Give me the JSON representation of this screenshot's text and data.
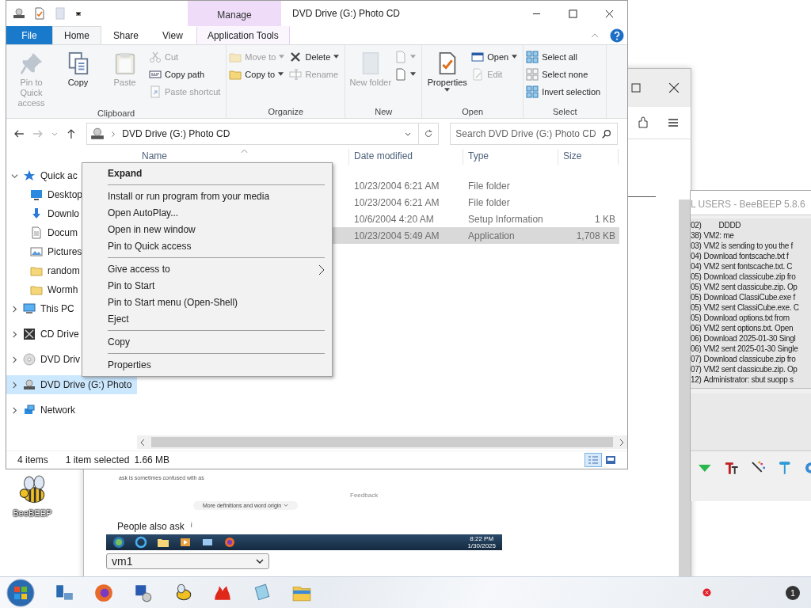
{
  "browser": {
    "snippet": "ask is sometimes confused with as",
    "feedback": "Feedback",
    "more_button": "More definitions and word origin",
    "people_also_ask": "People also ask",
    "info_mark": "i",
    "vm_taskbar": {
      "time": "8:22 PM",
      "date": "1/30/2025"
    },
    "vm_select": "vm1"
  },
  "beebeep": {
    "title": "L USERS - BeeBEEP 5.8.6",
    "messages": [
      {
        "time": "02)",
        "text": "DDDD",
        "kind": "indented"
      },
      {
        "time": "38)",
        "text": "VM2: me",
        "kind": "plain"
      },
      {
        "time": "03)",
        "text": "VM2 is sending to you the f",
        "kind": "plain"
      },
      {
        "time": "04)",
        "text": "Download fontscache.txt f",
        "kind": "plain"
      },
      {
        "time": "04)",
        "text": "VM2 sent fontscache.txt. C",
        "kind": "plain"
      },
      {
        "time": "05)",
        "text": "Download classicube.zip fro",
        "kind": "plain"
      },
      {
        "time": "05)",
        "text": "VM2 sent classicube.zip. Op",
        "kind": "plain"
      },
      {
        "time": "05)",
        "text": "Download ClassiCube.exe f",
        "kind": "plain"
      },
      {
        "time": "05)",
        "text": "VM2 sent ClassiCube.exe. C",
        "kind": "plain"
      },
      {
        "time": "05)",
        "text": "Download options.txt from",
        "kind": "plain"
      },
      {
        "time": "06)",
        "text": "VM2 sent options.txt. Open",
        "kind": "plain"
      },
      {
        "time": "06)",
        "text": "Download 2025-01-30 Singl",
        "kind": "plain"
      },
      {
        "time": "06)",
        "text": "VM2 sent 2025-01-30 Single",
        "kind": "plain"
      },
      {
        "time": "07)",
        "text": "Download classicube.zip fro",
        "kind": "plain"
      },
      {
        "time": "07)",
        "text": "VM2 sent classicube.zip. Op",
        "kind": "plain"
      },
      {
        "time": "12)",
        "text": "Administrator: sbut suopp s",
        "kind": "plain"
      }
    ]
  },
  "desktop_icons": [
    {
      "label": "BeeBEEP"
    }
  ],
  "taskbar": {
    "notification_count": "1"
  },
  "explorer": {
    "title": "DVD Drive (G:) Photo CD",
    "contextual_group": "Manage",
    "tabs": [
      {
        "label": "File",
        "kind": "file",
        "selected": false
      },
      {
        "label": "Home",
        "kind": "normal",
        "selected": true
      },
      {
        "label": "Share",
        "kind": "normal",
        "selected": false
      },
      {
        "label": "View",
        "kind": "normal",
        "selected": false
      },
      {
        "label": "Application Tools",
        "kind": "contextual",
        "selected": false
      }
    ],
    "ribbon_groups": [
      {
        "label": "Clipboard",
        "items": [
          {
            "kind": "large",
            "label": "Pin to Quick access",
            "disabled": true,
            "dropdown": false
          },
          {
            "kind": "large",
            "label": "Copy",
            "disabled": false,
            "dropdown": false
          },
          {
            "kind": "large",
            "label": "Paste",
            "disabled": true,
            "dropdown": false
          },
          {
            "kind": "stack",
            "commands": [
              {
                "label": "Cut",
                "disabled": true,
                "dropdown": false
              },
              {
                "label": "Copy path",
                "disabled": false,
                "dropdown": false
              },
              {
                "label": "Paste shortcut",
                "disabled": true,
                "dropdown": false
              }
            ]
          }
        ]
      },
      {
        "label": "Organize",
        "items": [
          {
            "kind": "stack",
            "commands": [
              {
                "label": "Move to",
                "disabled": true,
                "dropdown": true
              },
              {
                "label": "Copy to",
                "disabled": false,
                "dropdown": true
              }
            ]
          },
          {
            "kind": "stack",
            "commands": [
              {
                "label": "Delete",
                "disabled": false,
                "dropdown": true
              },
              {
                "label": "Rename",
                "disabled": true,
                "dropdown": false
              }
            ]
          }
        ]
      },
      {
        "label": "New",
        "items": [
          {
            "kind": "large",
            "label": "New folder",
            "disabled": true,
            "dropdown": false
          },
          {
            "kind": "stack",
            "commands": [
              {
                "disabled": true,
                "dropdown": true
              },
              {
                "disabled": false,
                "dropdown": true
              }
            ]
          }
        ]
      },
      {
        "label": "Open",
        "items": [
          {
            "kind": "large",
            "label": "Properties",
            "disabled": false,
            "dropdown": true
          },
          {
            "kind": "stack",
            "commands": [
              {
                "label": "Open",
                "disabled": false,
                "dropdown": true
              },
              {
                "label": "Edit",
                "disabled": true,
                "dropdown": false
              }
            ]
          }
        ]
      },
      {
        "label": "Select",
        "items": [
          {
            "kind": "stack",
            "commands": [
              {
                "label": "Select all",
                "disabled": false,
                "dropdown": false
              },
              {
                "label": "Select none",
                "disabled": false,
                "dropdown": false
              },
              {
                "label": "Invert selection",
                "disabled": false,
                "dropdown": false
              }
            ]
          }
        ]
      }
    ],
    "address": "DVD Drive (G:) Photo CD",
    "search": {
      "placeholder": "Search DVD Drive (G:) Photo CD"
    },
    "nav": [
      {
        "label": "Quick ac",
        "expanded": true,
        "selected": false,
        "children": [
          {
            "label": "Desktop",
            "selected": false
          },
          {
            "label": "Downlo",
            "selected": false
          },
          {
            "label": "Docum",
            "selected": false
          },
          {
            "label": "Pictures",
            "selected": false
          },
          {
            "label": "random",
            "selected": false
          },
          {
            "label": "Wormh",
            "selected": false
          }
        ]
      },
      {
        "label": "This PC",
        "expanded": false,
        "selected": false
      },
      {
        "label": "CD Drive",
        "expanded": false,
        "selected": false
      },
      {
        "label": "DVD Driv",
        "expanded": false,
        "selected": false
      },
      {
        "label": "DVD Drive (G:) Photo",
        "expanded": false,
        "selected": true
      },
      {
        "label": "Network",
        "expanded": false,
        "selected": false
      }
    ],
    "columns": [
      "Name",
      "Date modified",
      "Type",
      "Size"
    ],
    "rows": [
      {
        "date": "10/23/2004 6:21 AM",
        "type": "File folder",
        "selected": false
      },
      {
        "date": "10/23/2004 6:21 AM",
        "type": "File folder",
        "selected": false
      },
      {
        "date": "10/6/2004 4:20 AM",
        "type": "Setup Information",
        "size": "1 KB",
        "selected": false
      },
      {
        "date": "10/23/2004 5:49 AM",
        "type": "Application",
        "size": "1,708 KB",
        "selected": true
      }
    ],
    "status": {
      "count": "4 items",
      "selection": "1 item selected",
      "size": "1.66 MB"
    },
    "view_buttons": [
      {
        "selected": true
      },
      {
        "selected": false
      }
    ]
  },
  "context_menu": [
    {
      "kind": "default",
      "label": "Expand"
    },
    {
      "kind": "separator"
    },
    {
      "kind": "item",
      "label": "Install or run program from your media"
    },
    {
      "kind": "item",
      "label": "Open AutoPlay..."
    },
    {
      "kind": "item",
      "label": "Open in new window"
    },
    {
      "kind": "item",
      "label": "Pin to Quick access"
    },
    {
      "kind": "separator"
    },
    {
      "kind": "submenu",
      "label": "Give access to"
    },
    {
      "kind": "item",
      "label": "Pin to Start"
    },
    {
      "kind": "item",
      "label": "Pin to Start menu (Open-Shell)"
    },
    {
      "kind": "item",
      "label": "Eject"
    },
    {
      "kind": "separator"
    },
    {
      "kind": "item",
      "label": "Copy"
    },
    {
      "kind": "separator"
    },
    {
      "kind": "item",
      "label": "Properties"
    }
  ]
}
